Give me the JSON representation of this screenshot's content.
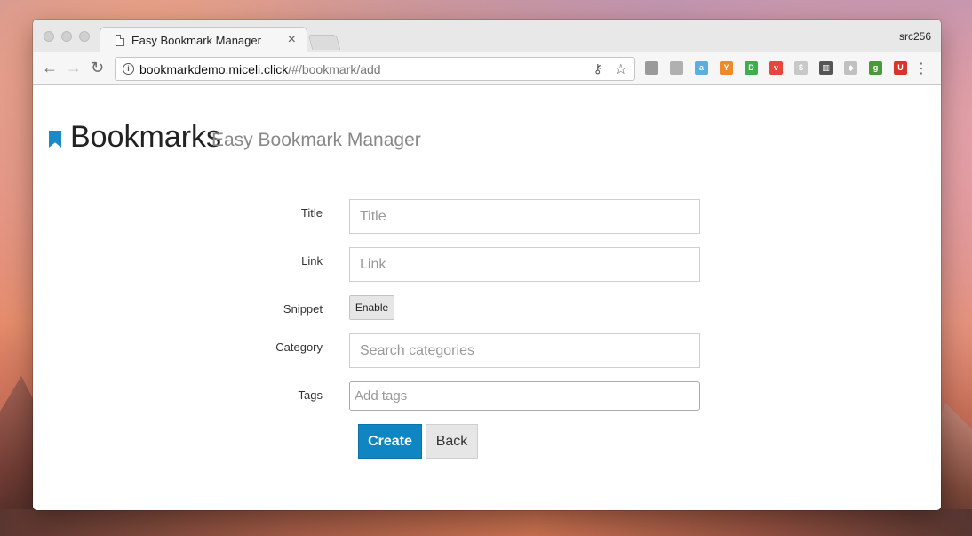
{
  "browser": {
    "tab_title": "Easy Bookmark Manager",
    "tab_close": "×",
    "profile_name": "src256",
    "url_host": "bookmarkdemo.miceli.click",
    "url_path": "/#/bookmark/add",
    "nav": {
      "back": "←",
      "forward": "→",
      "reload": "↻"
    },
    "extensions": [
      {
        "name": "doc-ext-icon",
        "color": "#9a9a9a",
        "glyph": ""
      },
      {
        "name": "pin-ext-icon",
        "color": "#b0b0b0",
        "glyph": ""
      },
      {
        "name": "translate-ext-icon",
        "color": "#5aaee0",
        "glyph": "a"
      },
      {
        "name": "y-ext-icon",
        "color": "#f0892a",
        "glyph": "Y"
      },
      {
        "name": "green-d-ext-icon",
        "color": "#3cae4a",
        "glyph": "D"
      },
      {
        "name": "pocket-ext-icon",
        "color": "#e8453c",
        "glyph": "v"
      },
      {
        "name": "dollar-ext-icon",
        "color": "#c8c8c8",
        "glyph": "$"
      },
      {
        "name": "archive-ext-icon",
        "color": "#555555",
        "glyph": "▥"
      },
      {
        "name": "diamond-ext-icon",
        "color": "#c0c0c0",
        "glyph": "◆"
      },
      {
        "name": "g-ext-icon",
        "color": "#4a9a3a",
        "glyph": "g"
      },
      {
        "name": "red-ext-icon",
        "color": "#d9332b",
        "glyph": "U"
      }
    ]
  },
  "app": {
    "title": "Bookmarks",
    "subtitle": "Easy Bookmark Manager",
    "accent_color": "#1a8bc6"
  },
  "form": {
    "title_label": "Title",
    "title_placeholder": "Title",
    "link_label": "Link",
    "link_placeholder": "Link",
    "snippet_label": "Snippet",
    "snippet_button": "Enable",
    "category_label": "Category",
    "category_placeholder": "Search categories",
    "tags_label": "Tags",
    "tags_placeholder": "Add tags",
    "create_button": "Create",
    "back_button": "Back"
  }
}
